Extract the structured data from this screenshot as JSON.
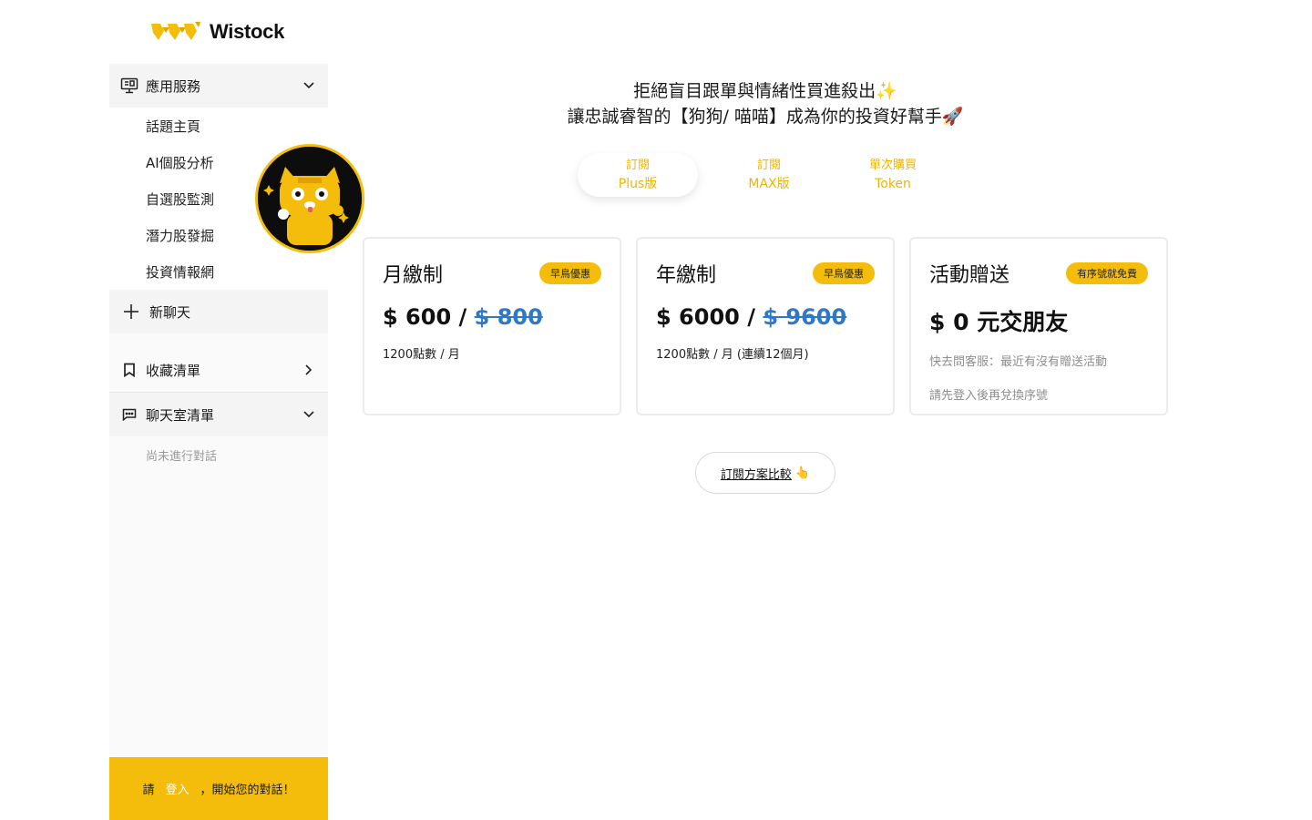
{
  "brand": {
    "name": "Wistock"
  },
  "sidebar": {
    "services": {
      "label": "應用服務",
      "icon": "presentation-icon"
    },
    "items": [
      {
        "label": "話題主頁"
      },
      {
        "label": "AI個股分析"
      },
      {
        "label": "自選股監測"
      },
      {
        "label": "潛力股發掘"
      },
      {
        "label": "投資情報網"
      }
    ],
    "new_chat": {
      "label": "新聊天",
      "icon": "plus-icon"
    },
    "favorites": {
      "label": "收藏清單",
      "icon": "bookmark-icon"
    },
    "chatrooms": {
      "label": "聊天室清單",
      "icon": "chat-icon"
    },
    "empty_text": "尚未進行對話",
    "login": {
      "prefix": "請",
      "link": "登入",
      "suffix": "，開始您的對話！"
    }
  },
  "headline": {
    "line1": "拒絕盲目跟單與情緒性買進殺出✨",
    "line2": "讓忠誠睿智的【狗狗/ 喵喵】成為你的投資好幫手🚀"
  },
  "tabs": [
    {
      "line1": "訂閱",
      "line2": "Plus版",
      "active": true
    },
    {
      "line1": "訂閱",
      "line2": "MAX版",
      "active": false
    },
    {
      "line1": "單次購買",
      "line2": "Token",
      "active": false
    }
  ],
  "cards": [
    {
      "title": "月繳制",
      "badge": "早鳥優惠",
      "price": "$ 600 / ",
      "old_price": "$ 800",
      "note": "1200點數 / 月"
    },
    {
      "title": "年繳制",
      "badge": "早鳥優惠",
      "price": "$ 6000 / ",
      "old_price": "$ 9600",
      "note": "1200點數 / 月 (連續12個月)"
    },
    {
      "title": "活動贈送",
      "badge": "有序號就免費",
      "price": "$ 0 元交朋友",
      "note1": "快去問客服：最近有沒有贈送活動",
      "note2": "請先登入後再兌換序號"
    }
  ],
  "compare": {
    "label": "訂閱方案比較",
    "emoji": "👆"
  },
  "colors": {
    "accent": "#f5bd0b",
    "strike_blue": "#2f78c7"
  }
}
